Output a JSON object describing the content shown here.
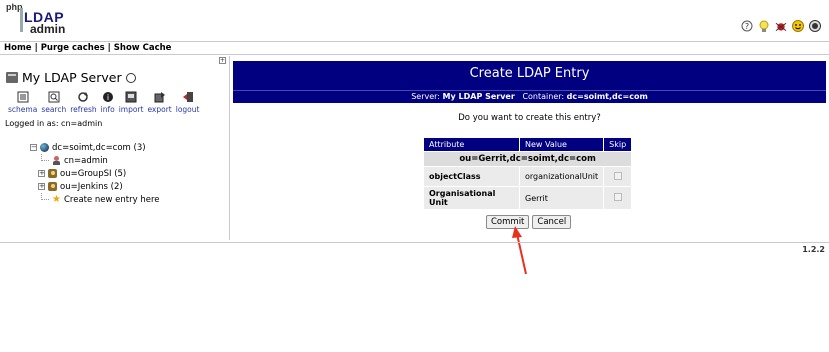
{
  "header": {
    "logo": {
      "php": "php",
      "ldap": "LDAP",
      "admin": "admin"
    },
    "icons": [
      "help-icon",
      "bulb-icon",
      "bug-icon",
      "smiley-icon",
      "info-icon"
    ]
  },
  "menu": {
    "home": "Home",
    "purge": "Purge caches",
    "show_cache": "Show Cache",
    "sep": "|"
  },
  "sidebar": {
    "server_name": "My LDAP Server",
    "toolbar": [
      {
        "label": "schema",
        "icon": "schema-icon"
      },
      {
        "label": "search",
        "icon": "search-icon"
      },
      {
        "label": "refresh",
        "icon": "refresh-icon"
      },
      {
        "label": "info",
        "icon": "info-icon"
      },
      {
        "label": "import",
        "icon": "import-icon"
      },
      {
        "label": "export",
        "icon": "export-icon"
      },
      {
        "label": "logout",
        "icon": "logout-icon"
      }
    ],
    "logged_in": "Logged in as: cn=admin",
    "tree": {
      "root": "dc=soimt,dc=com (3)",
      "children": [
        "cn=admin",
        "ou=GroupSI (5)",
        "ou=Jenkins (2)"
      ],
      "create": "Create new entry here"
    }
  },
  "main": {
    "title": "Create LDAP Entry",
    "server_label": "Server:",
    "server_value": "My LDAP Server",
    "container_label": "Container:",
    "container_value": "dc=soimt,dc=com",
    "question": "Do you want to create this entry?",
    "table": {
      "headers": [
        "Attribute",
        "New Value",
        "Skip"
      ],
      "dn": "ou=Gerrit,dc=soimt,dc=com",
      "rows": [
        {
          "attribute": "objectClass",
          "value": "organizationalUnit"
        },
        {
          "attribute": "Organisational Unit",
          "value": "Gerrit"
        }
      ]
    },
    "commit": "Commit",
    "cancel": "Cancel"
  },
  "footer": {
    "version": "1.2.2"
  },
  "colors": {
    "header_bg": "#010080",
    "annotation_arrow": "#e8301c"
  }
}
